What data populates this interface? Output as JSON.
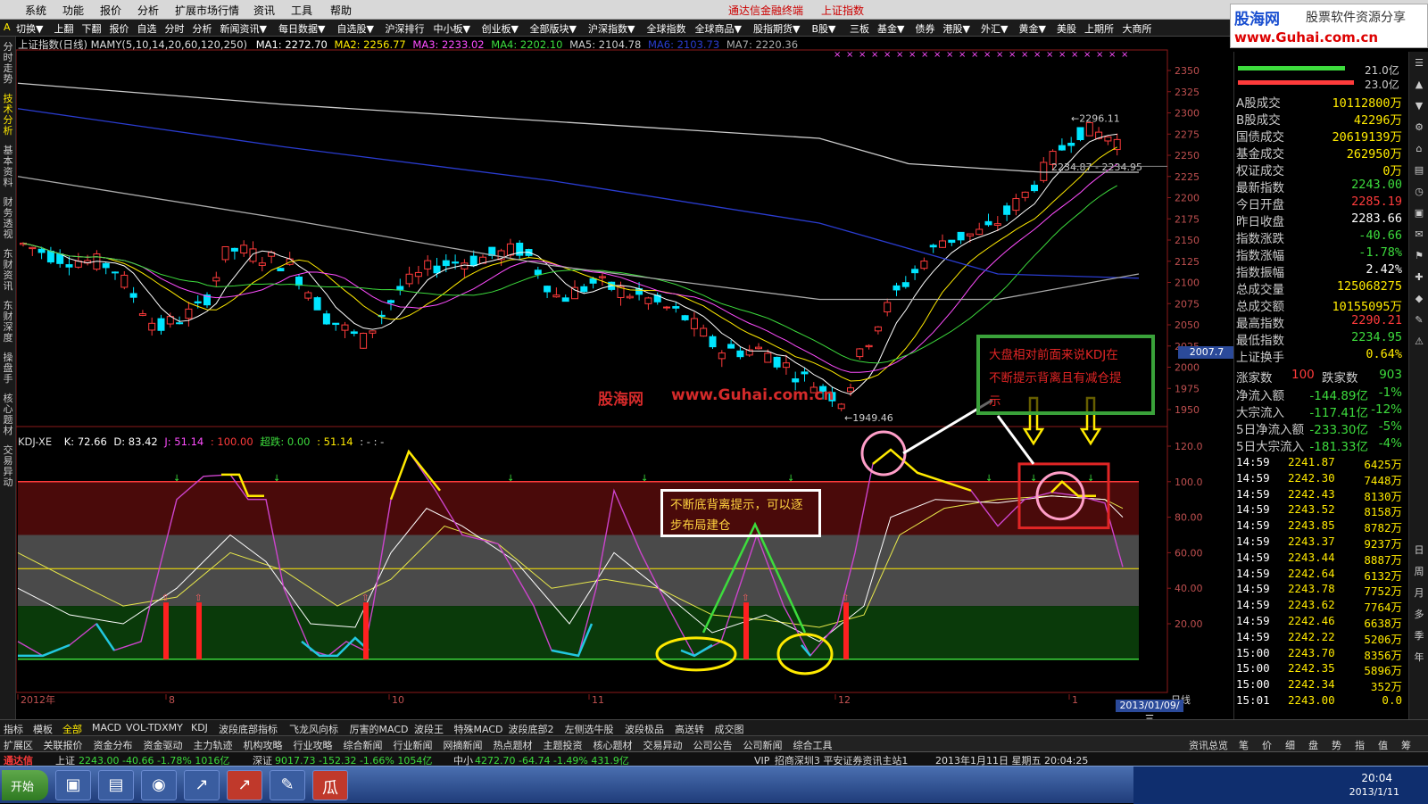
{
  "menu": {
    "items": [
      "系统",
      "功能",
      "报价",
      "分析",
      "扩展市场行情",
      "资讯",
      "工具",
      "帮助"
    ],
    "app_title": "通达信金融终端",
    "index_title": "上证指数"
  },
  "logo": {
    "line1": "股海网",
    "line1b": "股票软件资源分享",
    "line2": "www.Guhai.com.cn"
  },
  "toolbar": {
    "items": [
      "切换▼",
      "上翻",
      "下翻",
      "报价",
      "自选",
      "分时",
      "分析",
      "新闻资讯▼",
      "每日数据▼",
      "自选股▼",
      "沪深排行",
      "中小板▼",
      "创业板▼",
      "全部版块▼",
      "沪深指数▼",
      "全球指数",
      "全球商品▼",
      "股指期货▼",
      "B股▼",
      "三板",
      "基金▼",
      "债券",
      "港股▼",
      "外汇▼",
      "黄金▼",
      "美股",
      "上期所",
      "大商所"
    ]
  },
  "left_tabs": [
    "分时走势",
    "技术分析",
    "基本资料",
    "财务透视",
    "东财资讯",
    "东财深度",
    "操盘手",
    "核心题材",
    "交易异动"
  ],
  "ma_line": {
    "title": "上证指数(日线) MAMY(5,10,14,20,60,120,250)",
    "ma1": "MA1: 2272.70",
    "ma2": "MA2: 2256.77",
    "ma3": "MA3: 2233.02",
    "ma4": "MA4: 2202.10",
    "ma5": "MA5: 2104.78",
    "ma6": "MA6: 2103.73",
    "ma7": "MA7: 2220.36"
  },
  "kdj_line": {
    "name": "KDJ-XE",
    "k": "K: 72.66",
    "d": "D: 83.42",
    "j": "J: 51.14",
    "v100": ": 100.00",
    "chao": "超跌: 0.00",
    "v51": ": 51.14",
    "tail": ": - : -"
  },
  "price_axis": [
    "2350",
    "2325",
    "2300",
    "2275",
    "2250",
    "2225",
    "2200",
    "2175",
    "2150",
    "2125",
    "2100",
    "2075",
    "2050",
    "2025",
    "2000",
    "1975",
    "1950"
  ],
  "kdj_axis": [
    "120.0",
    "100.0",
    "80.00",
    "60.00",
    "40.00",
    "20.00"
  ],
  "axis_highlight": "2007.7",
  "price_annotations": {
    "high": "2296.11",
    "range": "2234.87 - 2234.95",
    "low": "1949.46"
  },
  "date_axis": {
    "labels": [
      "2012年",
      "8",
      "10",
      "11",
      "12",
      "1"
    ],
    "current": "2013/01/09/三",
    "period": "日线"
  },
  "annotations": {
    "box1": [
      "不断底背离提示，可以逐",
      "步布局建仓"
    ],
    "box2": [
      "大盘相对前面来说KDJ在",
      "不断提示背离且有减仓提",
      "示"
    ]
  },
  "watermark": {
    "a": "股海网",
    "b": "www.Guhai.com.cn"
  },
  "right_top": {
    "line1": "21.0亿",
    "line2": "23.0亿"
  },
  "right_stats": [
    {
      "label": "A股成交",
      "value": "10112800万",
      "color": "#ffea00"
    },
    {
      "label": "B股成交",
      "value": "42296万",
      "color": "#ffea00"
    },
    {
      "label": "国债成交",
      "value": "20619139万",
      "color": "#ffea00"
    },
    {
      "label": "基金成交",
      "value": "262950万",
      "color": "#ffea00"
    },
    {
      "label": "权证成交",
      "value": "0万",
      "color": "#ffea00"
    },
    {
      "label": "最新指数",
      "value": "2243.00",
      "color": "#3ddc3d"
    },
    {
      "label": "今日开盘",
      "value": "2285.19",
      "color": "#ff3b3b"
    },
    {
      "label": "昨日收盘",
      "value": "2283.66",
      "color": "#ffffff"
    },
    {
      "label": "指数涨跌",
      "value": "-40.66",
      "color": "#3ddc3d"
    },
    {
      "label": "指数涨幅",
      "value": "-1.78%",
      "color": "#3ddc3d"
    },
    {
      "label": "指数振幅",
      "value": "2.42%",
      "color": "#ffffff"
    },
    {
      "label": "总成交量",
      "value": "125068275",
      "color": "#ffea00"
    },
    {
      "label": "总成交额",
      "value": "10155095万",
      "color": "#ffea00"
    },
    {
      "label": "最高指数",
      "value": "2290.21",
      "color": "#ff3b3b"
    },
    {
      "label": "最低指数",
      "value": "2234.95",
      "color": "#3ddc3d"
    },
    {
      "label": "上证换手",
      "value": "0.64%",
      "color": "#ffea00"
    }
  ],
  "updown": {
    "up_label": "涨家数",
    "up": "100",
    "down_label": "跌家数",
    "down": "903"
  },
  "flows": [
    {
      "label": "净流入额",
      "value": "-144.89亿",
      "pct": "-1%"
    },
    {
      "label": "大宗流入",
      "value": "-117.41亿",
      "pct": "-12%"
    },
    {
      "label": "5日净流入额",
      "value": "-233.30亿",
      "pct": "-5%"
    },
    {
      "label": "5日大宗流入",
      "value": "-181.33亿",
      "pct": "-4%"
    }
  ],
  "ticks": [
    {
      "t": "14:59",
      "p": "2241.87",
      "v": "6425万"
    },
    {
      "t": "14:59",
      "p": "2242.30",
      "v": "7448万"
    },
    {
      "t": "14:59",
      "p": "2242.43",
      "v": "8130万"
    },
    {
      "t": "14:59",
      "p": "2243.52",
      "v": "8158万"
    },
    {
      "t": "14:59",
      "p": "2243.85",
      "v": "8782万"
    },
    {
      "t": "14:59",
      "p": "2243.37",
      "v": "9237万"
    },
    {
      "t": "14:59",
      "p": "2243.44",
      "v": "8887万"
    },
    {
      "t": "14:59",
      "p": "2242.64",
      "v": "6132万"
    },
    {
      "t": "14:59",
      "p": "2243.78",
      "v": "7752万"
    },
    {
      "t": "14:59",
      "p": "2243.62",
      "v": "7764万"
    },
    {
      "t": "14:59",
      "p": "2242.46",
      "v": "6638万"
    },
    {
      "t": "14:59",
      "p": "2242.22",
      "v": "5206万"
    },
    {
      "t": "15:00",
      "p": "2243.70",
      "v": "8356万"
    },
    {
      "t": "15:00",
      "p": "2242.35",
      "v": "5896万"
    },
    {
      "t": "15:00",
      "p": "2242.34",
      "v": "352万"
    },
    {
      "t": "15:01",
      "p": "2243.00",
      "v": "0.0"
    }
  ],
  "right_strip": [
    "日",
    "周",
    "月",
    "多",
    "季",
    "年"
  ],
  "bottom_tabs1": [
    "指标",
    "模板",
    "全部",
    "MACD",
    "VOL-TDXMY",
    "KDJ",
    "波段底部指标",
    "飞龙风向标",
    "厉害的MACD",
    "波段王",
    "特殊MACD",
    "波段底部2",
    "左侧选牛股",
    "波段极品",
    "高送转",
    "成交图"
  ],
  "bottom_tabs2": [
    "扩展区",
    "关联报价",
    "资金分布",
    "资金驱动",
    "主力轨迹",
    "机构攻略",
    "行业攻略",
    "综合新闻",
    "行业新闻",
    "网摘新闻",
    "热点题材",
    "主题投资",
    "核心题材",
    "交易异动",
    "公司公告",
    "公司新闻",
    "综合工具"
  ],
  "bottom_right": [
    "资讯总览",
    "笔",
    "价",
    "细",
    "盘",
    "势",
    "指",
    "值",
    "筹"
  ],
  "status": {
    "app": "通达信",
    "sh": "上证",
    "sh_val": "2243.00  -40.66  -1.78%  1016亿",
    "sz": "深证",
    "sz_val": "9017.73  -152.32  -1.66%  1054亿",
    "zx": "中小",
    "zx_val": "4272.70  -64.74  -1.49%  431.9亿",
    "vip": "VIP_招商深圳3  平安证券资讯主站1",
    "date": "2013年1月11日 星期五 20:04:25"
  },
  "taskbar": {
    "start": "开始",
    "clock_time": "20:04",
    "clock_date": "2013/1/11"
  },
  "colors": {
    "up": "#ff3b3b",
    "down": "#00e5ff",
    "ma1": "#ffffff",
    "ma2": "#ffea00",
    "ma3": "#ff4dff",
    "ma4": "#3ddc3d",
    "ma5": "#cccccc",
    "ma6": "#2a3ccf",
    "ma7": "#aaaaaa"
  }
}
